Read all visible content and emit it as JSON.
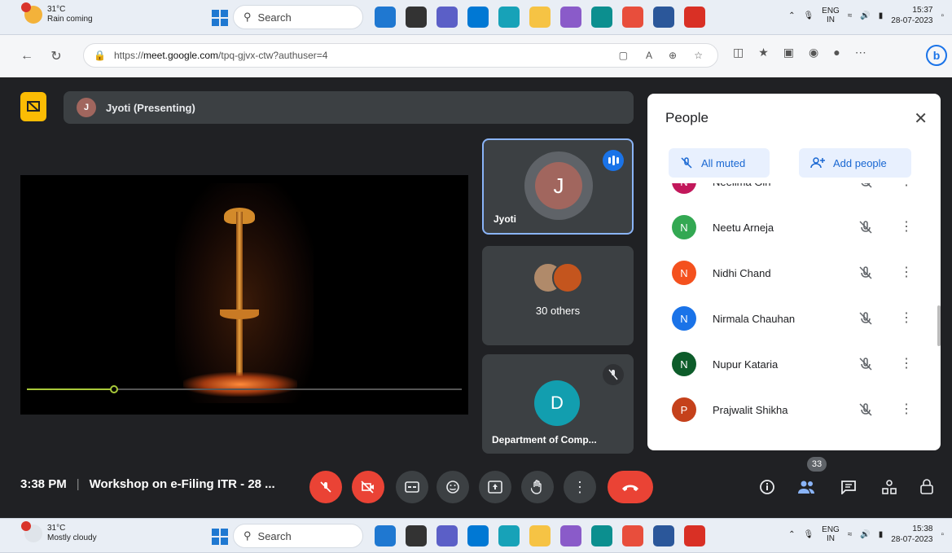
{
  "taskbar_top": {
    "temp": "31°C",
    "weather": "Rain coming",
    "search": "Search",
    "lang1": "ENG",
    "lang2": "IN",
    "time": "15:37",
    "date": "28-07-2023"
  },
  "taskbar_bottom": {
    "temp": "31°C",
    "weather": "Mostly cloudy",
    "search": "Search",
    "lang1": "ENG",
    "lang2": "IN",
    "time": "15:38",
    "date": "28-07-2023"
  },
  "browser": {
    "url_prefix": "https://",
    "url_domain": "meet.google.com",
    "url_path": "/tpq-gjvx-ctw?authuser=4"
  },
  "meet": {
    "presenter_initial": "J",
    "presenter_label": "Jyoti (Presenting)",
    "video_progress": 0.2,
    "tiles": {
      "speaker_initial": "J",
      "speaker_name": "Jyoti",
      "others_label": "30 others",
      "dept_initial": "D",
      "dept_name": "Department of Comp..."
    },
    "time": "3:38 PM",
    "meeting_title": "Workshop on e-Filing ITR - 28 ...",
    "participant_count": "33"
  },
  "people_panel": {
    "title": "People",
    "all_muted": "All muted",
    "add_people": "Add people",
    "participants": [
      {
        "initial": "N",
        "name": "Neelima Giri",
        "color": "#c2185b"
      },
      {
        "initial": "N",
        "name": "Neetu Arneja",
        "color": "#33a852"
      },
      {
        "initial": "N",
        "name": "Nidhi Chand",
        "color": "#f4511e"
      },
      {
        "initial": "N",
        "name": "Nirmala Chauhan",
        "color": "#1a73e8"
      },
      {
        "initial": "N",
        "name": "Nupur Kataria",
        "color": "#0d5c2a"
      },
      {
        "initial": "P",
        "name": "Prajwalit Shikha",
        "color": "#c5411b"
      }
    ]
  },
  "colors": {
    "meet_bg": "#202124",
    "tile_bg": "#3c4043",
    "accent_blue": "#1a73e8",
    "red": "#ea4335",
    "yellow": "#fbbc04"
  }
}
